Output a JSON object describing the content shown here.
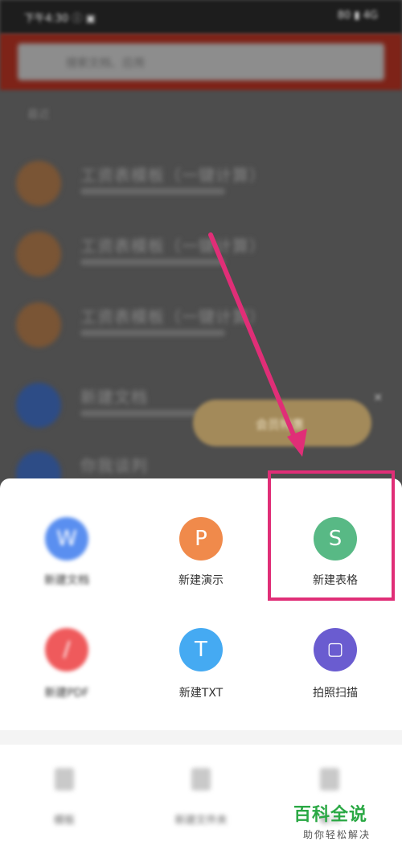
{
  "status_bar": {
    "left": "下午4:30 ⓘ ▣",
    "right": "80 ▮ 4G"
  },
  "search": {
    "placeholder": "搜索文档、应用"
  },
  "section_label": "最近",
  "recent_items": [
    {
      "title": "工资表模板（一键计算）",
      "avatar_color": "#7a5535"
    },
    {
      "title": "工资表模板（一键计算）",
      "avatar_color": "#7a5535"
    },
    {
      "title": "工资表模板（一键计算）",
      "avatar_color": "#7a5535"
    },
    {
      "title": "新建文档",
      "avatar_color": "#2d4c86"
    },
    {
      "title": "你我谈判",
      "avatar_color": "#2d4c86"
    }
  ],
  "promo": {
    "text": "会员特惠"
  },
  "create_menu": {
    "items": [
      {
        "label": "新建文档",
        "icon": "document-icon",
        "glyph": "W",
        "color": "#5a8ff0"
      },
      {
        "label": "新建演示",
        "icon": "presentation-icon",
        "glyph": "P",
        "color": "#f08a4b"
      },
      {
        "label": "新建表格",
        "icon": "spreadsheet-icon",
        "glyph": "S",
        "color": "#58b985"
      },
      {
        "label": "新建PDF",
        "icon": "pdf-icon",
        "glyph": "/",
        "color": "#ef5a5c"
      },
      {
        "label": "新建TXT",
        "icon": "txt-icon",
        "glyph": "T",
        "color": "#45aaf2"
      },
      {
        "label": "拍照扫描",
        "icon": "scan-icon",
        "glyph": "▢",
        "color": "#6a5cd0"
      }
    ]
  },
  "bottom_actions": [
    {
      "label": "模板"
    },
    {
      "label": "新建文件夹"
    },
    {
      "label": "导入"
    }
  ],
  "annotation": {
    "color": "#e02e77"
  },
  "watermark": {
    "title": "百科全说",
    "subtitle": "助你轻松解决"
  }
}
